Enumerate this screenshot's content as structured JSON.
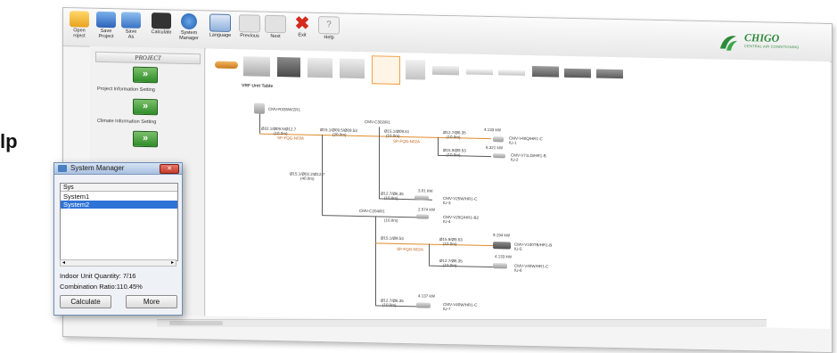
{
  "toolbar": {
    "buttons": [
      {
        "label": "Open\nroject",
        "icon": "open-folder-icon"
      },
      {
        "label": "Save\nProject",
        "icon": "save-icon"
      },
      {
        "label": "Save\nAs",
        "icon": "save-as-icon"
      },
      {
        "label": "Calculate",
        "icon": "calculator-icon"
      },
      {
        "label": "System\nManager",
        "icon": "info-icon"
      },
      {
        "label": "Language",
        "icon": "abc-icon"
      },
      {
        "label": "Previous",
        "icon": "arrow-left-icon"
      },
      {
        "label": "Next",
        "icon": "arrow-right-icon"
      },
      {
        "label": "Exit",
        "icon": "close-icon"
      },
      {
        "label": "Help",
        "icon": "help-icon"
      }
    ]
  },
  "brand": {
    "name": "CHIGO",
    "tagline": "CENTRAL AIR CONDITIONING",
    "color": "#2d8a3a"
  },
  "sidebar": {
    "header": "PROJECT",
    "steps": [
      {
        "label": "Project Information Setting"
      },
      {
        "label": "Climate Information Setting"
      },
      {
        "label": ""
      }
    ]
  },
  "page_fragment": "lp",
  "diagram": {
    "title": "VRF Unit Table",
    "outdoor": {
      "model": "CMV-R335W/ZR1"
    },
    "branches": [
      {
        "name": "CMV-C302/R1"
      },
      {
        "name": "CMV-C204/R1"
      }
    ],
    "pipes": [
      {
        "size": "Ø22.1/Ø09.5/Ø12.7",
        "length": "(10.0m)"
      },
      {
        "size": "Ø15.1/Ø09.5/Ø09.53",
        "length": "(20.0m)"
      },
      {
        "size": "Ø15.1/Ø09.51",
        "length": "(10.0m)"
      },
      {
        "size": "Ø12.7/Ø6.35",
        "length": "(10.0m)"
      },
      {
        "size": "Ø15.9/Ø9.53",
        "length": "(10.0m)"
      },
      {
        "size": "Ø15.1/Ø02.2/Ø12.7",
        "length": "(40.0m)"
      },
      {
        "size": "Ø12.7/Ø6.35",
        "length": "(10.0m)"
      },
      {
        "size": "Ø15.1/Ø9.53",
        "length": "(10.0m)"
      },
      {
        "size": "Ø15.9/Ø9.53",
        "length": "(10.0m)"
      },
      {
        "size": "Ø12.7/Ø6.35",
        "length": "(10.0m)"
      },
      {
        "size": "Ø12.7/Ø6.35",
        "length": "(10.0m)"
      }
    ],
    "joints": [
      "SP-FQG-N03A",
      "SP-FQG-N02A",
      "SP-FQG-N02A"
    ],
    "indoor_units": [
      {
        "kw": "4.133 kW",
        "model": "CMV-V40Q/HR1-C",
        "tag": "IU-1"
      },
      {
        "kw": "6.321 kW",
        "model": "CMV-V71LD/HR1-B",
        "tag": "IU-2"
      },
      {
        "kw": "3.01 kW",
        "model": "CMV-V25W/HR1-C",
        "tag": "IU-3"
      },
      {
        "kw": "2.574 kW",
        "model": "CMV-V25G/HR1-B2",
        "tag": "IU-4"
      },
      {
        "kw": "9.194 kW",
        "model": "CMV-V100TB/HR1-B",
        "tag": "IU-5"
      },
      {
        "kw": "4.133 kW",
        "model": "CMV-V40W/HR1-C",
        "tag": "IU-6"
      },
      {
        "kw": "4.137 kW",
        "model": "CMV-V40W/HR1-C",
        "tag": "IU-7"
      }
    ]
  },
  "dialog": {
    "title": "System Manager",
    "column": "Sys",
    "rows": [
      "System1",
      "System2"
    ],
    "selected_index": 1,
    "indoor_qty_label": "Indoor Unit Quantity: 7/16",
    "combination_label": "Combination Ratio:110.45%",
    "calculate_label": "Calculate",
    "more_label": "More"
  },
  "colors": {
    "accent_orange": "#e08a2a",
    "selection_blue": "#2f73d6",
    "next_green": "#2f8c2a"
  }
}
